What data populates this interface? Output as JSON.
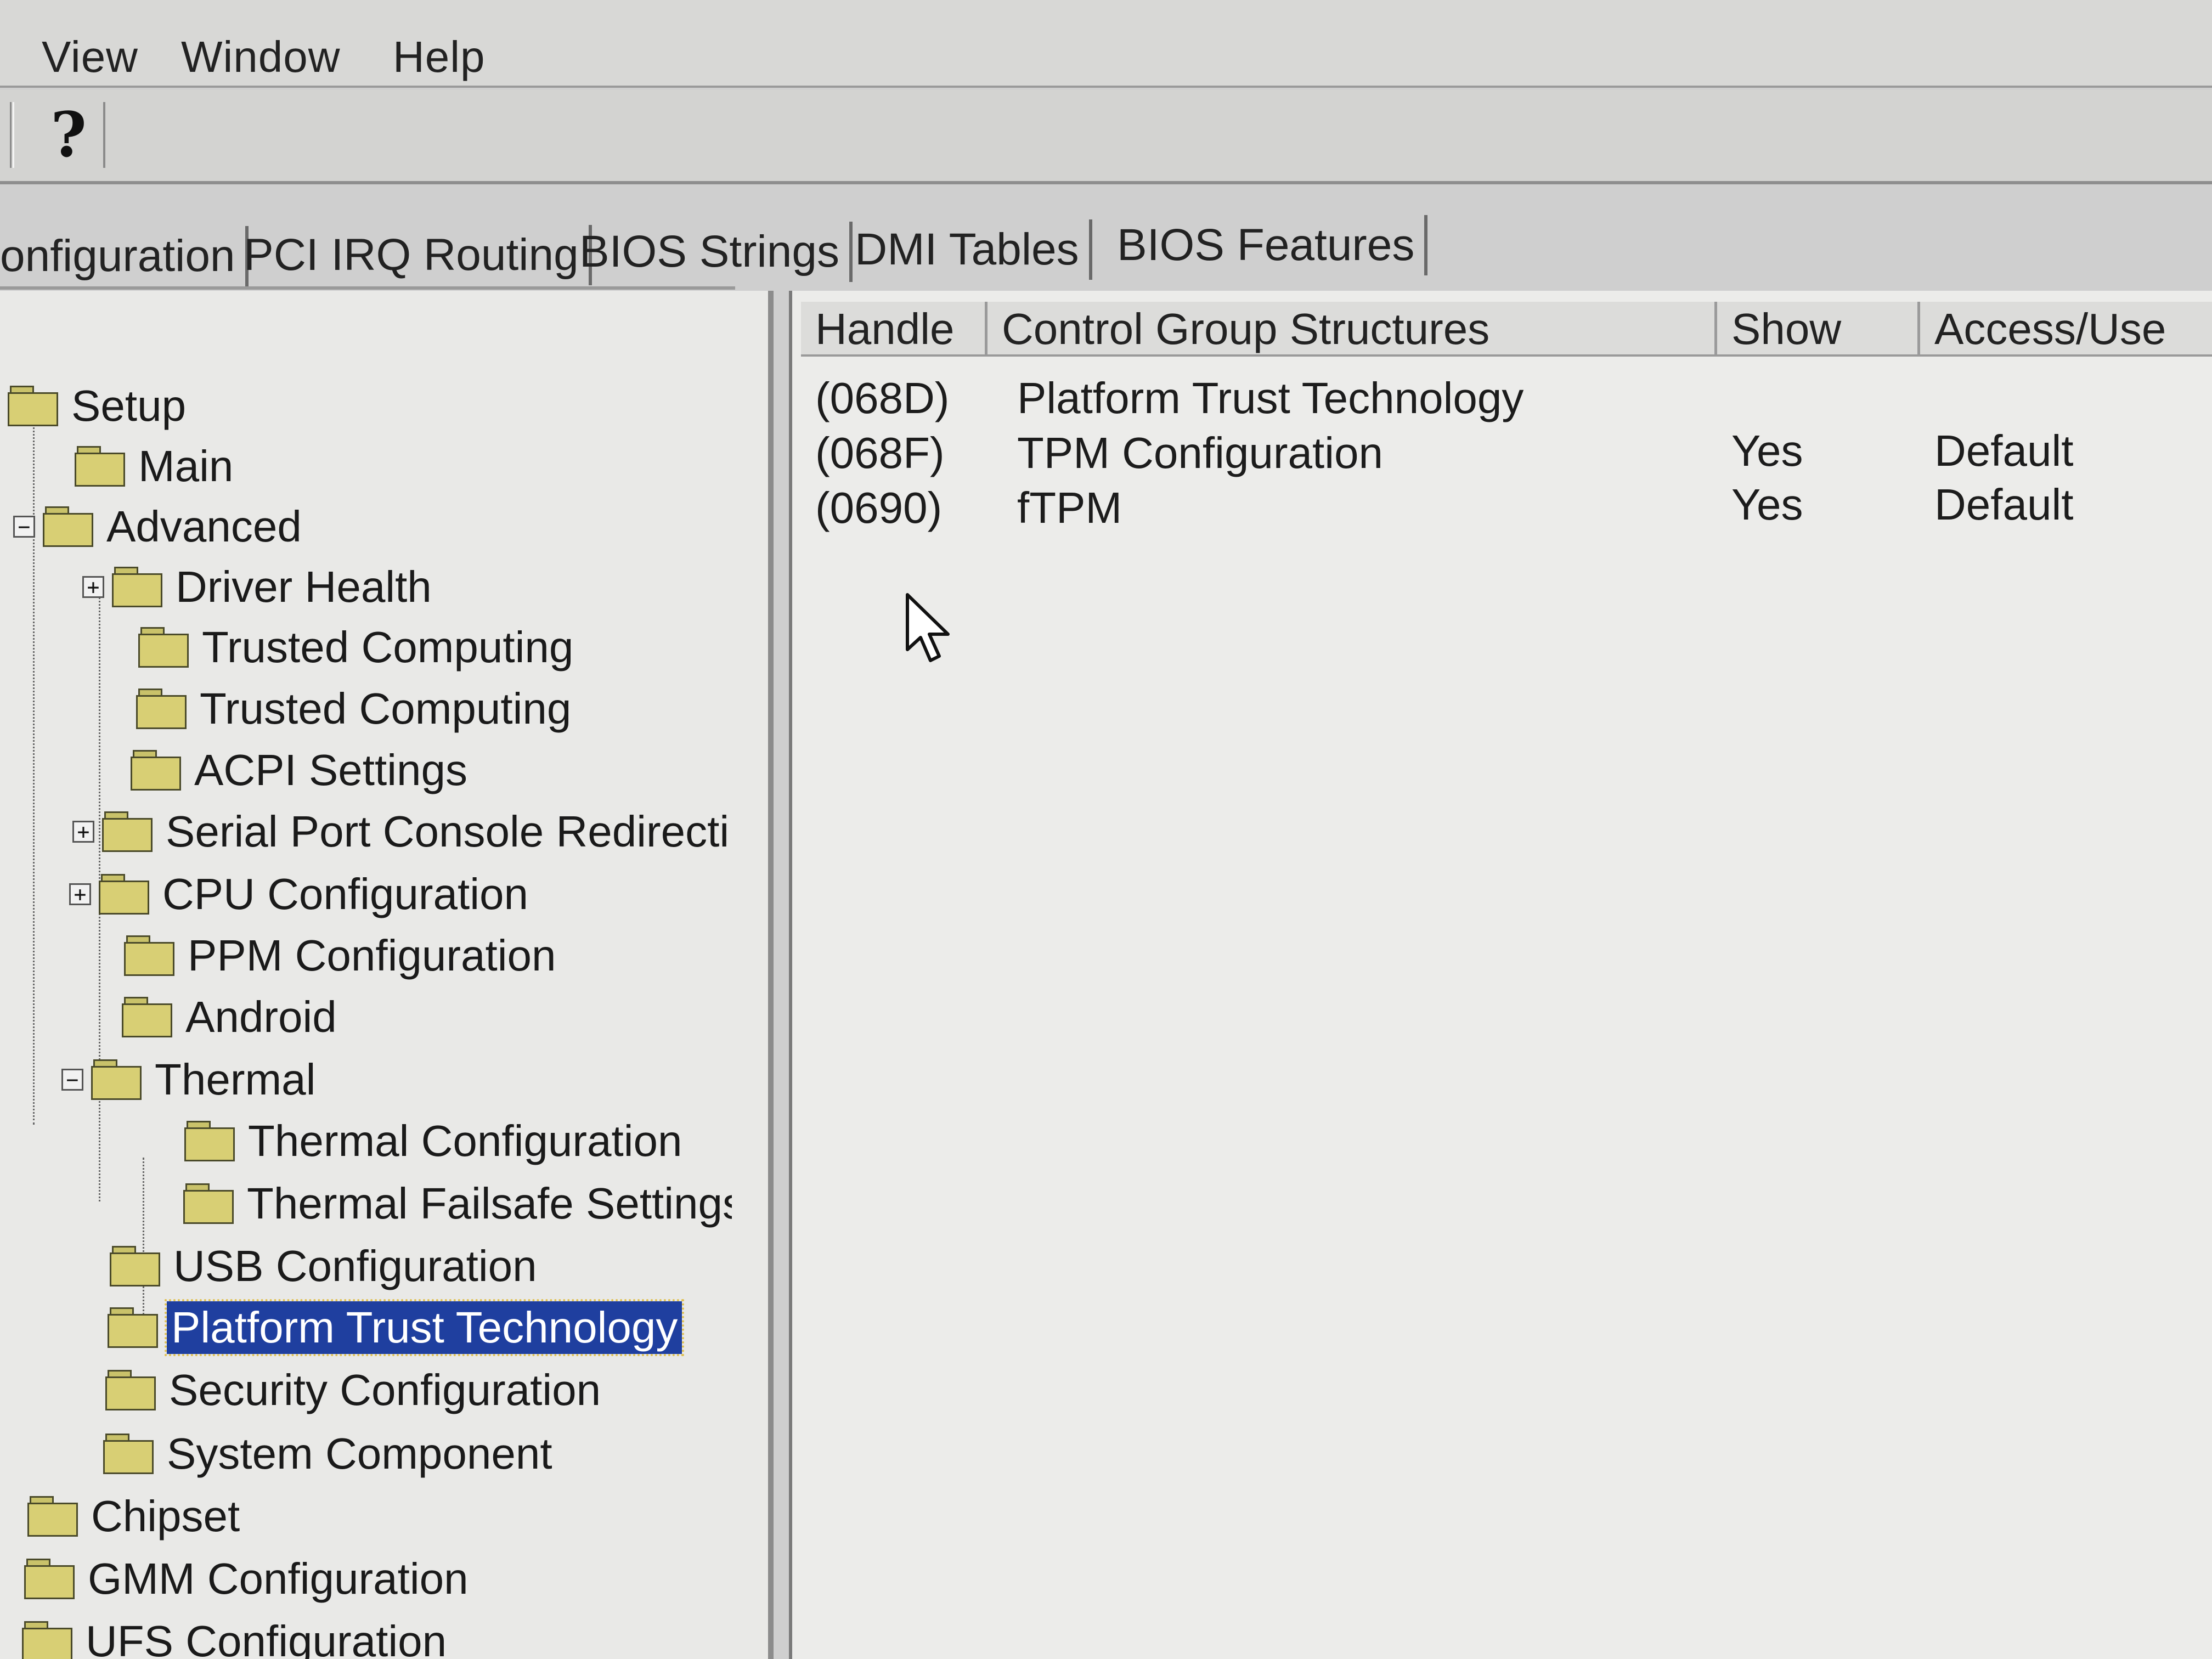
{
  "menu": {
    "view": "View",
    "window": "Window",
    "help": "Help"
  },
  "toolbar": {
    "help_glyph": "?"
  },
  "tabs": [
    {
      "label": "onfiguration"
    },
    {
      "label": "PCI IRQ Routing"
    },
    {
      "label": "BIOS Strings"
    },
    {
      "label": "DMI Tables"
    },
    {
      "label": "BIOS Features"
    }
  ],
  "tree": {
    "items": [
      {
        "label": "Setup"
      },
      {
        "label": "Main"
      },
      {
        "label": "Advanced"
      },
      {
        "label": "Driver Health"
      },
      {
        "label": "Trusted Computing"
      },
      {
        "label": "Trusted Computing"
      },
      {
        "label": "ACPI Settings"
      },
      {
        "label": "Serial Port Console Redirecti"
      },
      {
        "label": "CPU Configuration"
      },
      {
        "label": "PPM Configuration"
      },
      {
        "label": "Android"
      },
      {
        "label": "Thermal"
      },
      {
        "label": "Thermal Configuration"
      },
      {
        "label": "Thermal Failsafe Settings"
      },
      {
        "label": "USB Configuration"
      },
      {
        "label": "Platform Trust Technology",
        "selected": true
      },
      {
        "label": "Security Configuration"
      },
      {
        "label": "System Component"
      },
      {
        "label": "Chipset"
      },
      {
        "label": "GMM Configuration"
      },
      {
        "label": "UFS Configuration"
      }
    ],
    "expanders": {
      "collapse": "−",
      "expand": "+"
    }
  },
  "table": {
    "headers": {
      "handle": "Handle",
      "structures": "Control Group Structures",
      "show": "Show",
      "access": "Access/Use"
    },
    "rows": [
      {
        "handle": "(068D)",
        "structure": "Platform Trust Technology",
        "show": "",
        "access": ""
      },
      {
        "handle": "(068F)",
        "structure": "TPM Configuration",
        "show": "Yes",
        "access": "Default"
      },
      {
        "handle": "(0690)",
        "structure": "fTPM",
        "show": "Yes",
        "access": "Default"
      }
    ]
  },
  "colors": {
    "selection": "#1f3f9f",
    "folder": "#d8cf74"
  }
}
